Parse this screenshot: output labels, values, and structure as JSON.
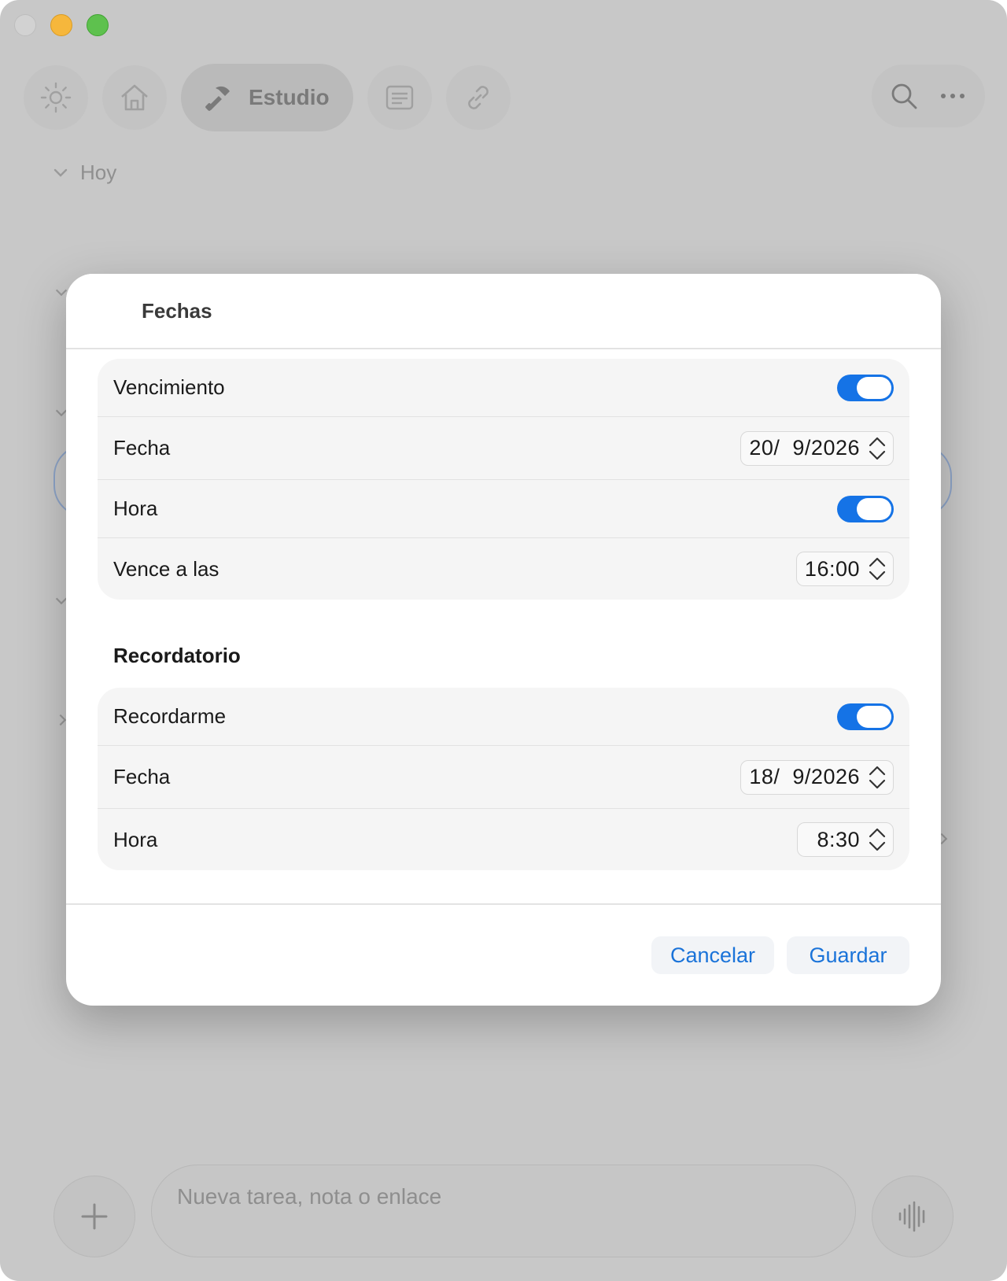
{
  "toolbar": {
    "active_tab_label": "Estudio",
    "icons": [
      "sun-icon",
      "home-icon",
      "hammer-icon",
      "notes-icon",
      "link-icon",
      "search-icon",
      "more-icon"
    ]
  },
  "section": {
    "today_label": "Hoy"
  },
  "bottom_bar": {
    "input_placeholder": "Nueva tarea, nota o enlace"
  },
  "dialog": {
    "title": "Fechas",
    "due": {
      "due_label": "Vencimiento",
      "due_enabled": true,
      "date_label": "Fecha",
      "date_value": "20/  9/2026",
      "time_toggle_label": "Hora",
      "time_enabled": true,
      "due_time_label": "Vence a las",
      "due_time_value": "16:00"
    },
    "reminder": {
      "section_title": "Recordatorio",
      "remind_label": "Recordarme",
      "remind_enabled": true,
      "date_label": "Fecha",
      "date_value": "18/  9/2026",
      "time_label": "Hora",
      "time_value": "8:30"
    },
    "cancel_label": "Cancelar",
    "save_label": "Guardar"
  },
  "colors": {
    "accent": "#1573e6",
    "button_text": "#1a73d9",
    "overlay": "#c8c8c8"
  }
}
